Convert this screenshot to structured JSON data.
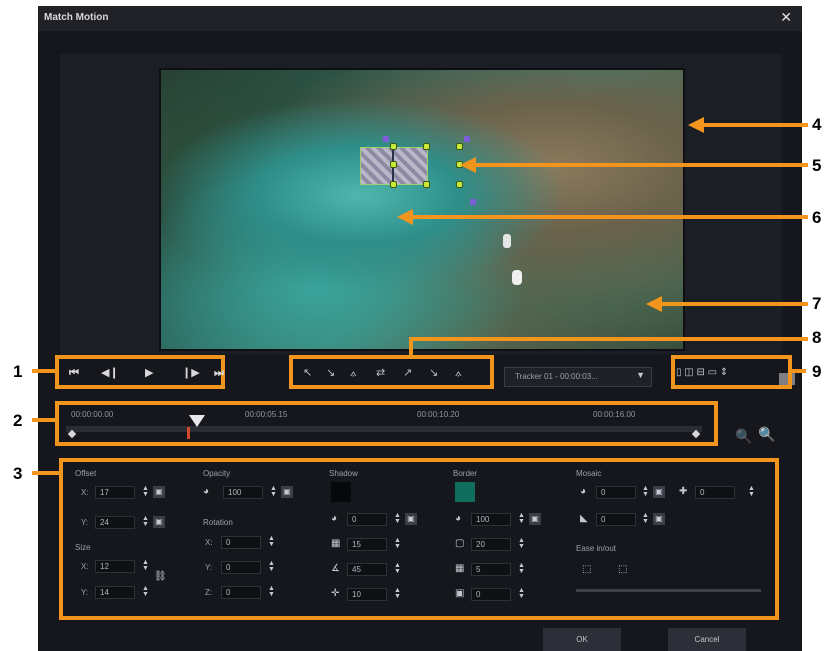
{
  "window": {
    "title": "Match Motion",
    "close_icon": "✕"
  },
  "annotations": [
    "1",
    "2",
    "3",
    "4",
    "5",
    "6",
    "7",
    "8",
    "9"
  ],
  "playback": {
    "buttons": [
      {
        "name": "go-to-start",
        "glyph": "⏮"
      },
      {
        "name": "previous-frame",
        "glyph": "◀❙"
      },
      {
        "name": "play",
        "glyph": "▶"
      },
      {
        "name": "next-frame",
        "glyph": "❙▶"
      },
      {
        "name": "go-to-end",
        "glyph": "⏭"
      }
    ]
  },
  "tracking_tools": [
    "↖",
    "↘",
    "⟑",
    "⇄",
    "↗",
    "↘",
    "⟑"
  ],
  "tracker_select": {
    "value": "Tracker 01 - 00:00:03...",
    "arrow": "▼"
  },
  "layout_buttons": "▯ ◫ ⊟ ▭ ⇕",
  "timeline": {
    "ticks": [
      "00:00:00.00",
      "00:00:05.15",
      "00:00:10.20",
      "00:00:16.00"
    ]
  },
  "zoom": {
    "zoom_out": "🔍",
    "zoom_in": "🔍"
  },
  "properties": {
    "offset": {
      "label": "Offset",
      "x_label": "X:",
      "x": "17",
      "y_label": "Y:",
      "y": "24"
    },
    "size": {
      "label": "Size",
      "x_label": "X:",
      "x": "12",
      "y_label": "Y:",
      "y": "14"
    },
    "opacity": {
      "label": "Opacity",
      "value": "100"
    },
    "rotation": {
      "label": "Rotation",
      "x_label": "X:",
      "x": "0",
      "y_label": "Y:",
      "y": "0",
      "z_label": "Z:",
      "z": "0"
    },
    "shadow": {
      "label": "Shadow",
      "color": "#07080c",
      "v1": "0",
      "v2": "15",
      "v3": "45",
      "v4": "10"
    },
    "border": {
      "label": "Border",
      "color": "#116d5d",
      "v1": "100",
      "v2": "20",
      "v3": "5",
      "v4": "0"
    },
    "mosaic": {
      "label": "Mosaic",
      "v1": "0",
      "v2": "0",
      "v3": "0",
      "ease": "Ease in/out"
    }
  },
  "footer": {
    "ok": "OK",
    "cancel": "Cancel"
  }
}
